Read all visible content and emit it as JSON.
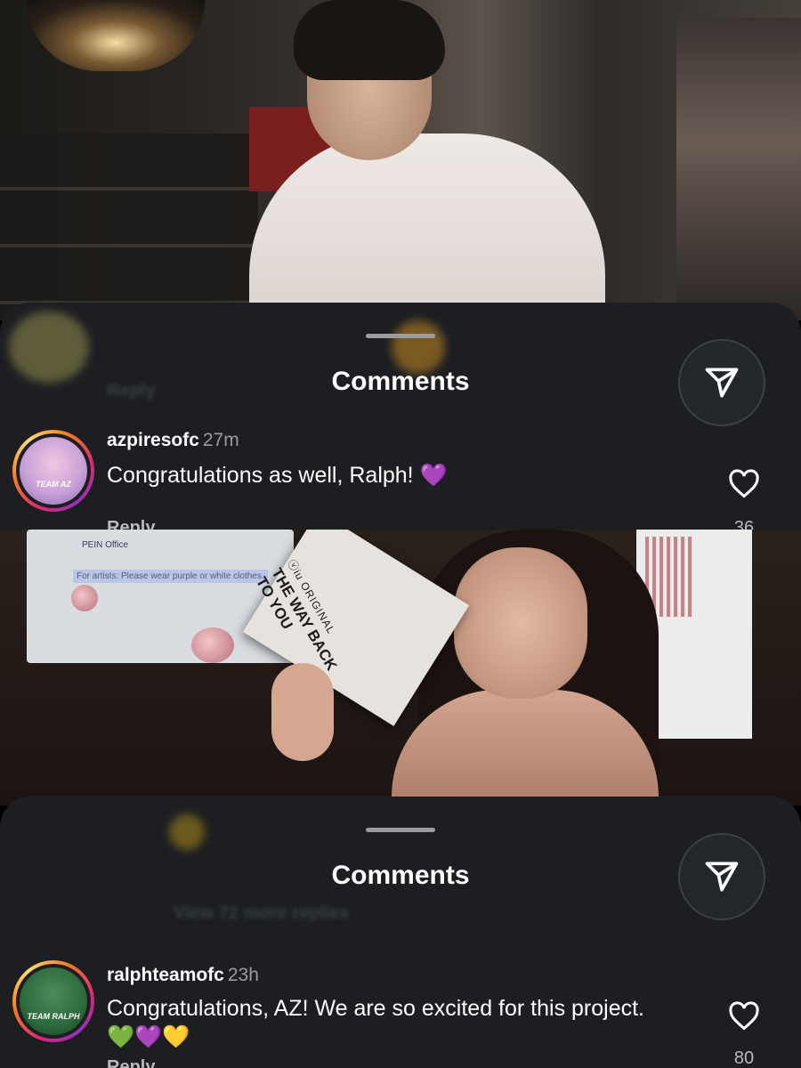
{
  "top_photo": {
    "alt": ""
  },
  "sheet1": {
    "title": "Comments",
    "comment": {
      "username": "azpiresofc",
      "time": "27m",
      "text": "Congratulations as well, Ralph! 💜",
      "reply_label": "Reply",
      "likes": "36",
      "avatar_label": "TEAM AZ"
    },
    "ghost_reply": "Reply"
  },
  "mid_photo": {
    "card_brand": "ⓥiu ORIGINAL",
    "card_title_line1": "THE WAY BACK",
    "card_title_line2": "TO YOU",
    "screen_notice": "For artists: Please wear purple or white clothes.",
    "screen_addr": "PEIN Office"
  },
  "sheet2": {
    "title": "Comments",
    "ghost_view_more": "View 72 more replies",
    "comment": {
      "username": "ralphteamofc",
      "time": "23h",
      "text": "Congratulations, AZ! We are so excited for this project. 💚💜💛",
      "reply_label": "Reply",
      "likes": "80",
      "avatar_label": "TEAM RALPH"
    }
  },
  "colors": {
    "sheet_bg": "#1c1e22",
    "text": "#ffffff",
    "muted": "#9a9ca2"
  },
  "icons": [
    "share-icon",
    "heart-icon"
  ]
}
